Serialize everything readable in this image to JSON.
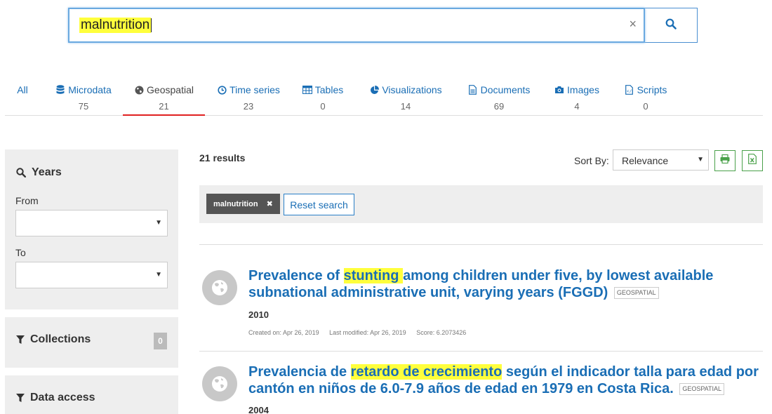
{
  "search": {
    "value": "malnutrition",
    "clear_glyph": "×"
  },
  "tabs": [
    {
      "label": "All",
      "count": "",
      "icon": ""
    },
    {
      "label": "Microdata",
      "count": "75",
      "icon": "database-icon"
    },
    {
      "label": "Geospatial",
      "count": "21",
      "icon": "globe-icon"
    },
    {
      "label": "Time series",
      "count": "23",
      "icon": "clock-icon"
    },
    {
      "label": "Tables",
      "count": "0",
      "icon": "table-icon"
    },
    {
      "label": "Visualizations",
      "count": "14",
      "icon": "pie-chart-icon"
    },
    {
      "label": "Documents",
      "count": "69",
      "icon": "document-icon"
    },
    {
      "label": "Images",
      "count": "4",
      "icon": "camera-icon"
    },
    {
      "label": "Scripts",
      "count": "0",
      "icon": "script-icon"
    }
  ],
  "sidebar": {
    "years": {
      "title": "Years",
      "from_label": "From",
      "to_label": "To"
    },
    "collections": {
      "title": "Collections",
      "count": "0"
    },
    "data_access": {
      "title": "Data access"
    }
  },
  "results_header": {
    "count_text": "21 results",
    "sort_label": "Sort By:",
    "sort_value": "Relevance"
  },
  "filters": {
    "chip": "malnutrition",
    "chip_remove": "✖",
    "reset_label": "Reset search"
  },
  "results": [
    {
      "title_pre": "Prevalence of ",
      "title_hl": "stunting ",
      "title_post": "among children under five, by lowest available subnational administrative unit, varying years (FGGD)",
      "tag": "GEOSPATIAL",
      "year": "2010",
      "created": "Created on: Apr 26, 2019",
      "modified": "Last modified: Apr 26, 2019",
      "score": "Score: 6.2073426"
    },
    {
      "title_pre": "Prevalencia de ",
      "title_hl": "retardo de crecimiento",
      "title_post": " según el indicador talla para edad por cantón en niños de 6.0-7.9 años de edad en 1979 en Costa Rica.",
      "tag": "GEOSPATIAL",
      "year": "2004"
    }
  ],
  "colors": {
    "link": "#1a6eb5",
    "highlight": "#ffff3c",
    "active_tab_underline": "#e02020",
    "export_green": "#4aa14a"
  }
}
